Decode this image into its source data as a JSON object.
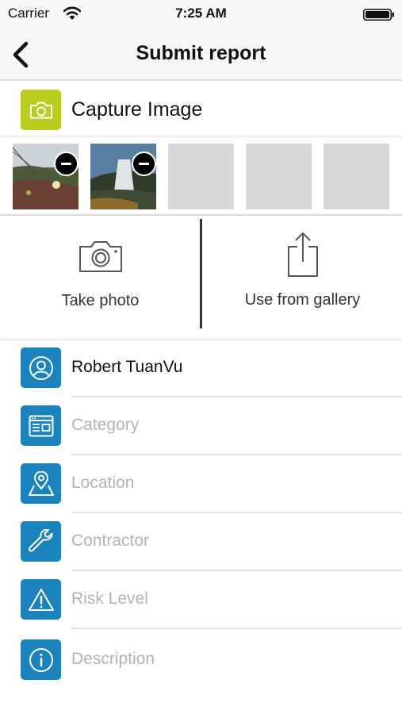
{
  "status_bar": {
    "carrier": "Carrier",
    "time": "7:25 AM",
    "icons": [
      "wifi-icon",
      "battery-icon"
    ]
  },
  "nav": {
    "title": "Submit report",
    "back_icon": "chevron-left-icon"
  },
  "capture": {
    "label": "Capture Image",
    "icon": "camera-icon",
    "color": "#b8cd1e"
  },
  "thumbnails": [
    {
      "state": "photo",
      "remove_icon": "minus-icon"
    },
    {
      "state": "photo",
      "remove_icon": "minus-icon"
    },
    {
      "state": "empty"
    },
    {
      "state": "empty"
    },
    {
      "state": "empty"
    }
  ],
  "actions": {
    "take_photo": {
      "label": "Take photo",
      "icon": "camera-outline-icon"
    },
    "gallery": {
      "label": "Use from gallery",
      "icon": "share-icon"
    }
  },
  "form": {
    "accent": "#1a82bc",
    "fields": [
      {
        "icon": "user-icon",
        "value": "Robert TuanVu",
        "placeholder": ""
      },
      {
        "icon": "category-icon",
        "value": "",
        "placeholder": "Category"
      },
      {
        "icon": "location-pin-icon",
        "value": "",
        "placeholder": "Location"
      },
      {
        "icon": "wrench-icon",
        "value": "",
        "placeholder": "Contractor"
      },
      {
        "icon": "warning-icon",
        "value": "",
        "placeholder": "Risk Level"
      },
      {
        "icon": "info-icon",
        "value": "",
        "placeholder": "Description"
      }
    ]
  }
}
